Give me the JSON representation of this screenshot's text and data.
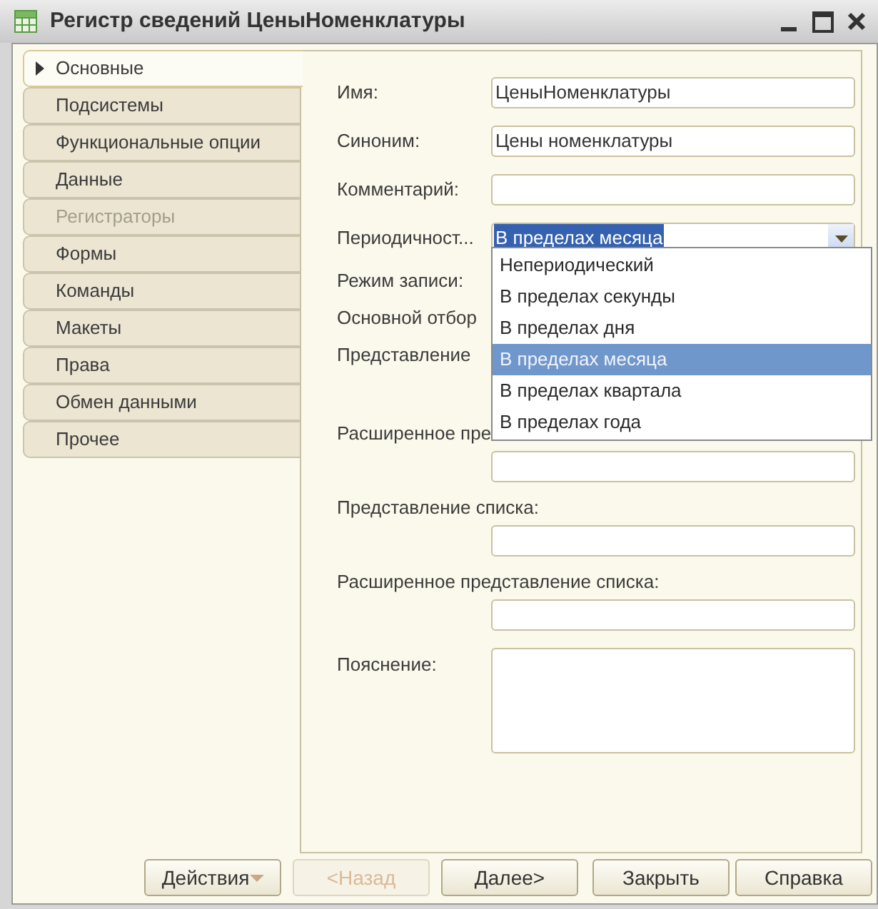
{
  "window": {
    "title": "Регистр сведений ЦеныНоменклатуры"
  },
  "tabs": [
    {
      "label": "Основные",
      "selected": true,
      "disabled": false
    },
    {
      "label": "Подсистемы",
      "selected": false,
      "disabled": false
    },
    {
      "label": "Функциональные опции",
      "selected": false,
      "disabled": false
    },
    {
      "label": "Данные",
      "selected": false,
      "disabled": false
    },
    {
      "label": "Регистраторы",
      "selected": false,
      "disabled": true
    },
    {
      "label": "Формы",
      "selected": false,
      "disabled": false
    },
    {
      "label": "Команды",
      "selected": false,
      "disabled": false
    },
    {
      "label": "Макеты",
      "selected": false,
      "disabled": false
    },
    {
      "label": "Права",
      "selected": false,
      "disabled": false
    },
    {
      "label": "Обмен данными",
      "selected": false,
      "disabled": false
    },
    {
      "label": "Прочее",
      "selected": false,
      "disabled": false
    }
  ],
  "fields": [
    {
      "kind": "text",
      "label": "Имя:",
      "value": "ЦеныНоменклатуры"
    },
    {
      "kind": "text",
      "label": "Синоним:",
      "value": "Цены номенклатуры"
    },
    {
      "kind": "text",
      "label": "Комментарий:"
    },
    {
      "kind": "combo",
      "label": "Периодичност...",
      "value": "В пределах месяца"
    },
    {
      "kind": "label",
      "label": "Режим записи:"
    },
    {
      "kind": "label",
      "label": "Основной отбор"
    },
    {
      "kind": "label",
      "label": "Представление"
    },
    {
      "kind": "stacked",
      "label": "Расширенное пре"
    },
    {
      "kind": "stacked",
      "label": "Представление списка:"
    },
    {
      "kind": "stacked",
      "label": "Расширенное представление списка:"
    },
    {
      "kind": "textarea",
      "label": "Пояснение:"
    }
  ],
  "dropdown": {
    "options": [
      {
        "label": "Непериодический",
        "selected": false
      },
      {
        "label": "В пределах секунды",
        "selected": false
      },
      {
        "label": "В пределах дня",
        "selected": false
      },
      {
        "label": "В пределах месяца",
        "selected": true
      },
      {
        "label": "В пределах квартала",
        "selected": false
      },
      {
        "label": "В пределах года",
        "selected": false
      }
    ]
  },
  "buttons": [
    {
      "label": "Действия",
      "disabled": false,
      "has_menu": true
    },
    {
      "label": "<Назад",
      "disabled": true,
      "has_menu": false
    },
    {
      "label": "Далее>",
      "disabled": false,
      "has_menu": false
    },
    {
      "label": "Закрыть",
      "disabled": false,
      "has_menu": false
    },
    {
      "label": "Справка",
      "disabled": false,
      "has_menu": false
    }
  ]
}
